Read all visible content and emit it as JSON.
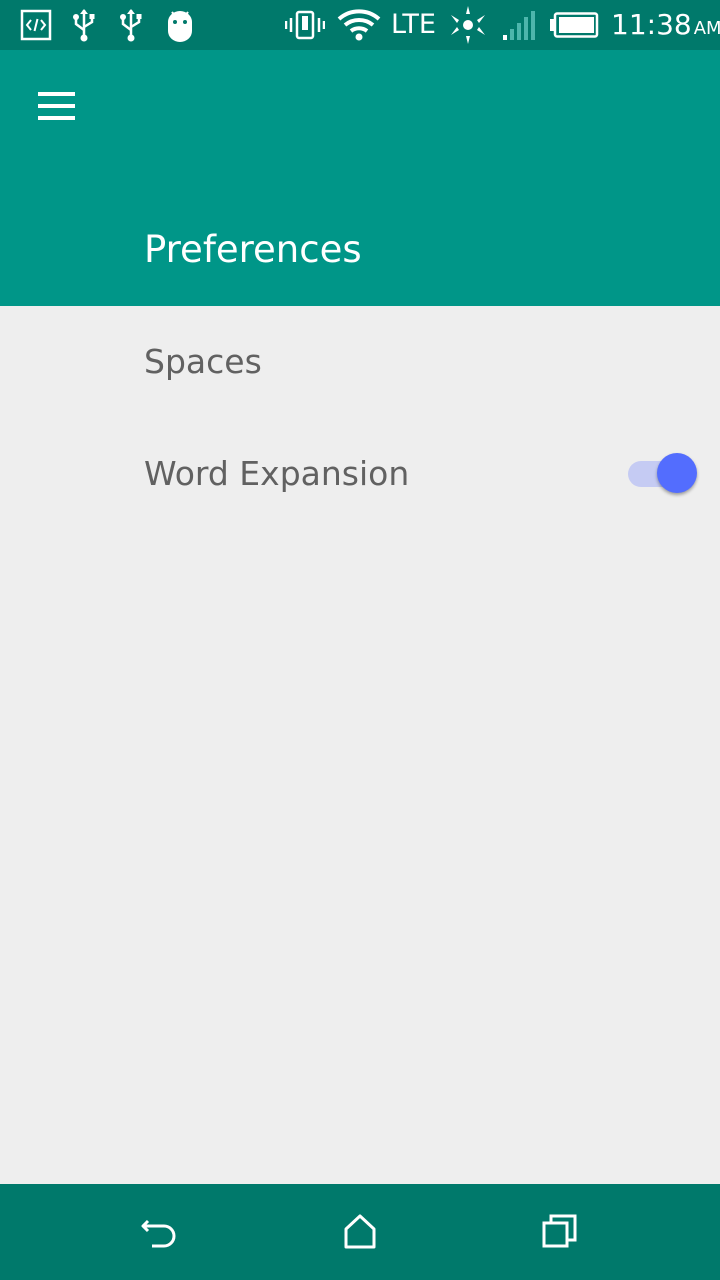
{
  "status_bar": {
    "left_icons": [
      "developer-mode-icon",
      "usb-icon",
      "usb-icon",
      "android-icon"
    ],
    "right_icons": [
      "vibrate-icon",
      "wifi-icon",
      "lte-label",
      "data-activity-icon",
      "cell-signal-icon",
      "battery-icon"
    ],
    "network": "LTE",
    "time": "11:38",
    "ampm": "AM"
  },
  "app_bar": {
    "menu_icon": "hamburger-menu-icon",
    "title": "Preferences",
    "color": "#009688"
  },
  "preferences": {
    "items": [
      {
        "label": "Spaces"
      },
      {
        "label": "Word Expansion",
        "toggle": true,
        "checked": true
      }
    ]
  },
  "nav_bar": {
    "buttons": [
      "back-icon",
      "home-icon",
      "recents-icon"
    ],
    "color": "#00796b"
  },
  "colors": {
    "status_bar": "#00796b",
    "background": "#eeeeee",
    "switch_thumb": "#536dfe",
    "switch_track": "#c5cbf3",
    "label_text": "#616161"
  }
}
